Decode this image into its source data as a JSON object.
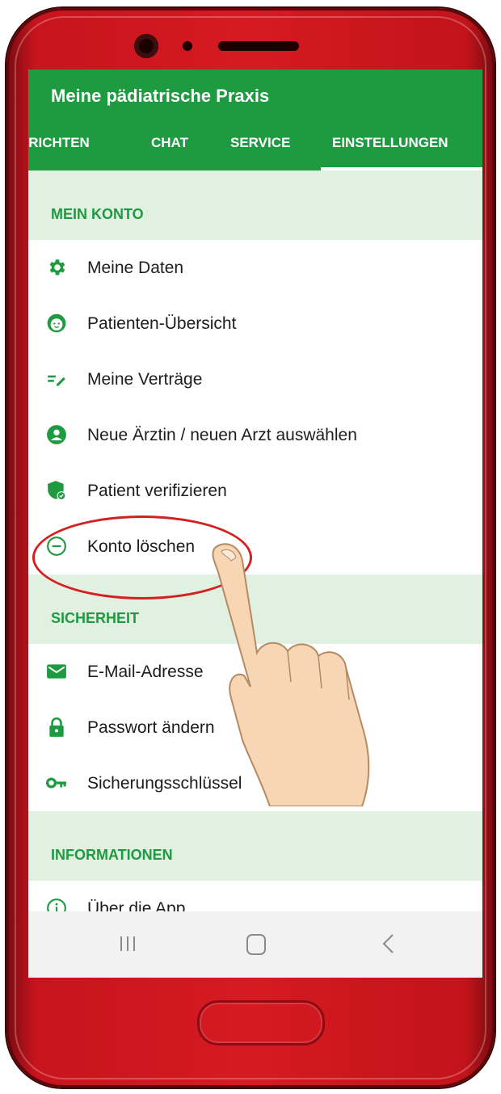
{
  "app": {
    "title": "Meine pädiatrische Praxis"
  },
  "tabs": [
    {
      "label": "HRICHTEN"
    },
    {
      "label": "CHAT"
    },
    {
      "label": "SERVICE"
    },
    {
      "label": "EINSTELLUNGEN",
      "active": true
    }
  ],
  "sections": {
    "account": {
      "label": "MEIN KONTO",
      "items": [
        {
          "label": "Meine Daten",
          "icon": "gear-icon"
        },
        {
          "label": "Patienten-Übersicht",
          "icon": "child-face-icon"
        },
        {
          "label": "Meine Verträge",
          "icon": "edit-list-icon"
        },
        {
          "label": "Neue Ärztin / neuen Arzt auswählen",
          "icon": "account-circle-icon"
        },
        {
          "label": "Patient verifizieren",
          "icon": "shield-check-icon"
        },
        {
          "label": "Konto löschen",
          "icon": "minus-circle-icon"
        }
      ]
    },
    "security": {
      "label": "SICHERHEIT",
      "items": [
        {
          "label": "E-Mail-Adresse",
          "icon": "envelope-icon"
        },
        {
          "label": "Passwort ändern",
          "icon": "lock-icon"
        },
        {
          "label": "Sicherungsschlüssel",
          "icon": "key-icon"
        }
      ]
    },
    "info": {
      "label": "INFORMATIONEN",
      "items": [
        {
          "label": "Über die App",
          "icon": "info-circle-icon"
        }
      ]
    }
  },
  "colors": {
    "primary": "#1e9a40",
    "section_bg": "#e0f0e1",
    "highlight": "#d42020",
    "phone": "#d51a22"
  }
}
